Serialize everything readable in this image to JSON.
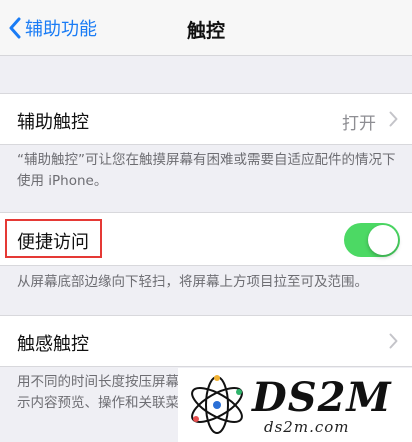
{
  "nav": {
    "back_label": "辅助功能",
    "title": "触控"
  },
  "assistive_touch": {
    "label": "辅助触控",
    "value": "打开",
    "footer": "“辅助触控”可让您在触摸屏幕有困难或需要自适应配件的情况下使用 iPhone。"
  },
  "reachability": {
    "label": "便捷访问",
    "toggle_on": true,
    "toggle_color": "#4cd964",
    "footer": "从屏幕底部边缘向下轻扫，将屏幕上方项目拉至可及范围。"
  },
  "haptic_touch": {
    "label": "触感触控",
    "footer": "用不同的时间长度按压屏幕以显示内容预览、操作和关联菜单。"
  },
  "watermark": {
    "logo_text": "DS2M",
    "url": "ds2m.com"
  },
  "colors": {
    "accent": "#1a7cf5",
    "highlight": "#e53935"
  }
}
